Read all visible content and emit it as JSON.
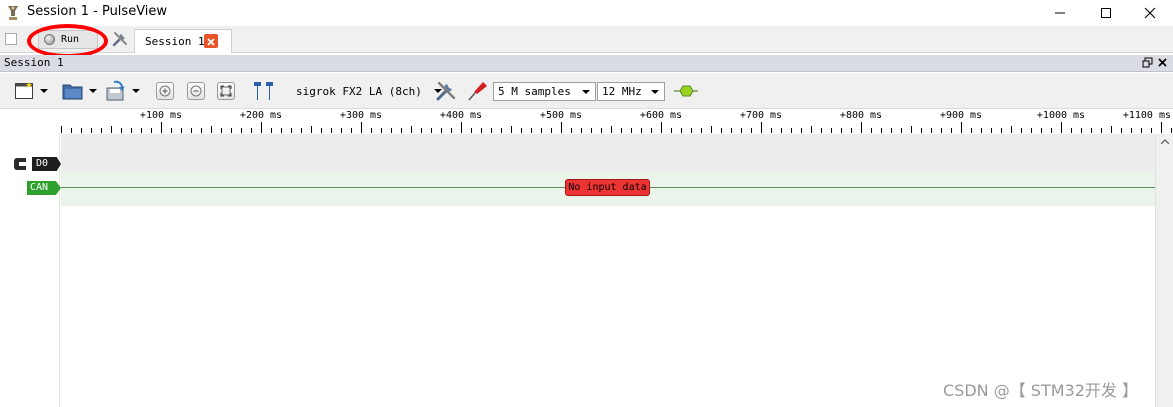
{
  "window": {
    "title": "Session 1 - PulseView"
  },
  "tabbar": {
    "run_label": "Run",
    "session_tab_label": "Session 1"
  },
  "dock": {
    "title": "Session 1"
  },
  "toolbar": {
    "device_label": "sigrok FX2 LA (8ch)",
    "samples_value": "5 M samples",
    "samplerate_value": "12 MHz"
  },
  "ruler": {
    "ticks": [
      "+100 ms",
      "+200 ms",
      "+300 ms",
      "+400 ms",
      "+500 ms",
      "+600 ms",
      "+700 ms",
      "+800 ms",
      "+900 ms",
      "+1000 ms",
      "+1100 ms"
    ]
  },
  "traces": {
    "channels": [
      {
        "label": "D0",
        "color": "#1e1e1e"
      },
      {
        "label": "CAN",
        "color": "#2ea02e"
      }
    ],
    "decoder_message": "No input data"
  },
  "colors": {
    "highlight_ring": "#ff0000",
    "error_badge": "#ee3333",
    "can_row": "#eaf4ea",
    "d0_row": "#ececec"
  },
  "watermark": "CSDN @【 STM32开发 】"
}
